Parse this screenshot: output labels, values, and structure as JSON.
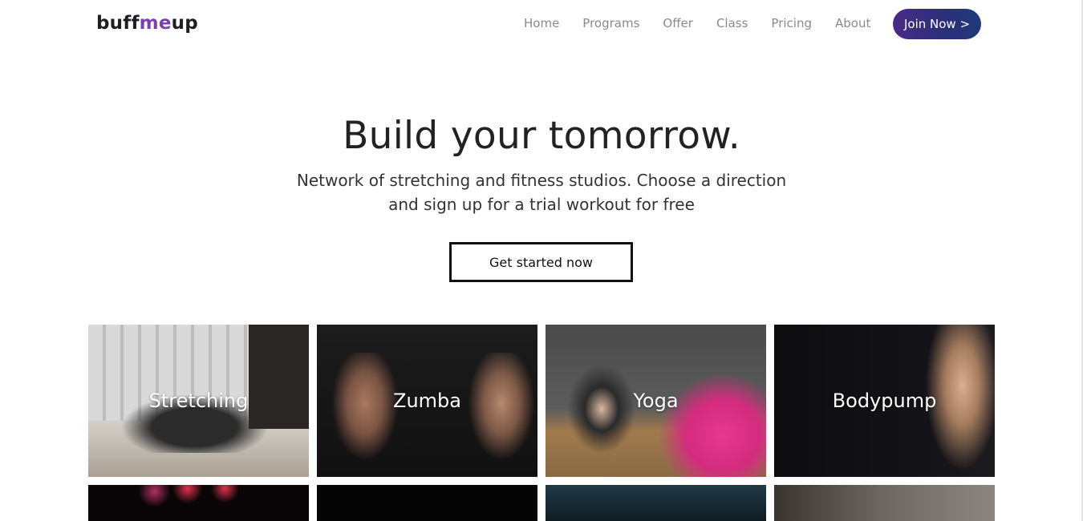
{
  "brand": {
    "logo_part1": "buff",
    "logo_part2": "me",
    "logo_part3": "up"
  },
  "nav": {
    "items": [
      "Home",
      "Programs",
      "Offer",
      "Class",
      "Pricing",
      "About"
    ],
    "join_label": "Join Now >"
  },
  "hero": {
    "title": "Build your tomorrow.",
    "subtitle_line1": "Network of stretching and fitness studios. Choose a direction",
    "subtitle_line2": "and sign up for a trial workout for free",
    "cta_label": "Get started now"
  },
  "programs": {
    "cards": [
      {
        "label": "Stretching"
      },
      {
        "label": "Zumba"
      },
      {
        "label": "Yoga"
      },
      {
        "label": "Bodypump"
      }
    ]
  },
  "colors": {
    "brand_accent": "#7b3fb0",
    "join_gradient_start": "#4a2a86",
    "join_gradient_end": "#1f3a78",
    "nav_text": "#8a8a8a"
  }
}
